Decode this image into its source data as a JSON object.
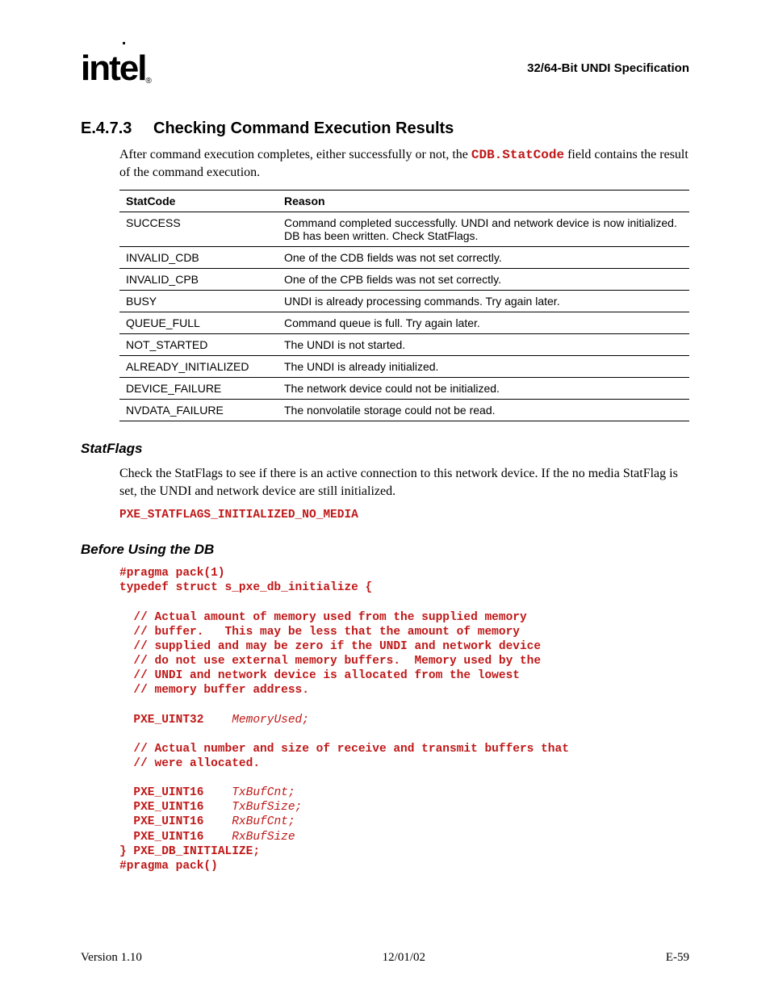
{
  "header": {
    "logo_text": "intel",
    "doc_title": "32/64-Bit UNDI Specification"
  },
  "section": {
    "number": "E.4.7.3",
    "title": "Checking Command Execution Results",
    "intro_a": "After command execution completes, either successfully or not, the ",
    "intro_code": "CDB.StatCode",
    "intro_b": " field contains the result of the command execution."
  },
  "table": {
    "head_a": "StatCode",
    "head_b": "Reason",
    "rows": [
      {
        "code": "SUCCESS",
        "reason": "Command completed successfully.  UNDI and network device is now initialized.  DB has been written.  Check StatFlags."
      },
      {
        "code": "INVALID_CDB",
        "reason": "One of the CDB fields was not set correctly."
      },
      {
        "code": "INVALID_CPB",
        "reason": "One of the CPB fields was not set correctly."
      },
      {
        "code": "BUSY",
        "reason": "UNDI is already processing commands.  Try again later."
      },
      {
        "code": "QUEUE_FULL",
        "reason": "Command queue is full.  Try again later."
      },
      {
        "code": "NOT_STARTED",
        "reason": "The UNDI is not started."
      },
      {
        "code": "ALREADY_INITIALIZED",
        "reason": "The UNDI is already initialized."
      },
      {
        "code": "DEVICE_FAILURE",
        "reason": "The network device could not be initialized."
      },
      {
        "code": "NVDATA_FAILURE",
        "reason": "The nonvolatile storage could not be read."
      }
    ]
  },
  "statflags": {
    "heading": "StatFlags",
    "text": "Check the StatFlags to see if there is an active connection to this network device.  If the no media StatFlag is set, the UNDI and network device are still initialized.",
    "code": "PXE_STATFLAGS_INITIALIZED_NO_MEDIA"
  },
  "db": {
    "heading": "Before Using the DB",
    "l01": "#pragma pack(1)",
    "l02": "typedef struct s_pxe_db_initialize {",
    "c01": "  // Actual amount of memory used from the supplied memory",
    "c02": "  // buffer.   This may be less that the amount of memory",
    "c03": "  // supplied and may be zero if the UNDI and network device",
    "c04": "  // do not use external memory buffers.  Memory used by the",
    "c05": "  // UNDI and network device is allocated from the lowest",
    "c06": "  // memory buffer address.",
    "t1a": "  PXE_UINT32    ",
    "t1b": "MemoryUsed;",
    "c07": "  // Actual number and size of receive and transmit buffers that",
    "c08": "  // were allocated.",
    "t2a": "  PXE_UINT16    ",
    "t2b": "TxBufCnt;",
    "t3a": "  PXE_UINT16    ",
    "t3b": "TxBufSize;",
    "t4a": "  PXE_UINT16    ",
    "t4b": "RxBufCnt;",
    "t5a": "  PXE_UINT16    ",
    "t5b": "RxBufSize",
    "l03": "} PXE_DB_INITIALIZE;",
    "l04": "#pragma pack()"
  },
  "footer": {
    "left": "Version 1.10",
    "center": "12/01/02",
    "right": "E-59"
  }
}
